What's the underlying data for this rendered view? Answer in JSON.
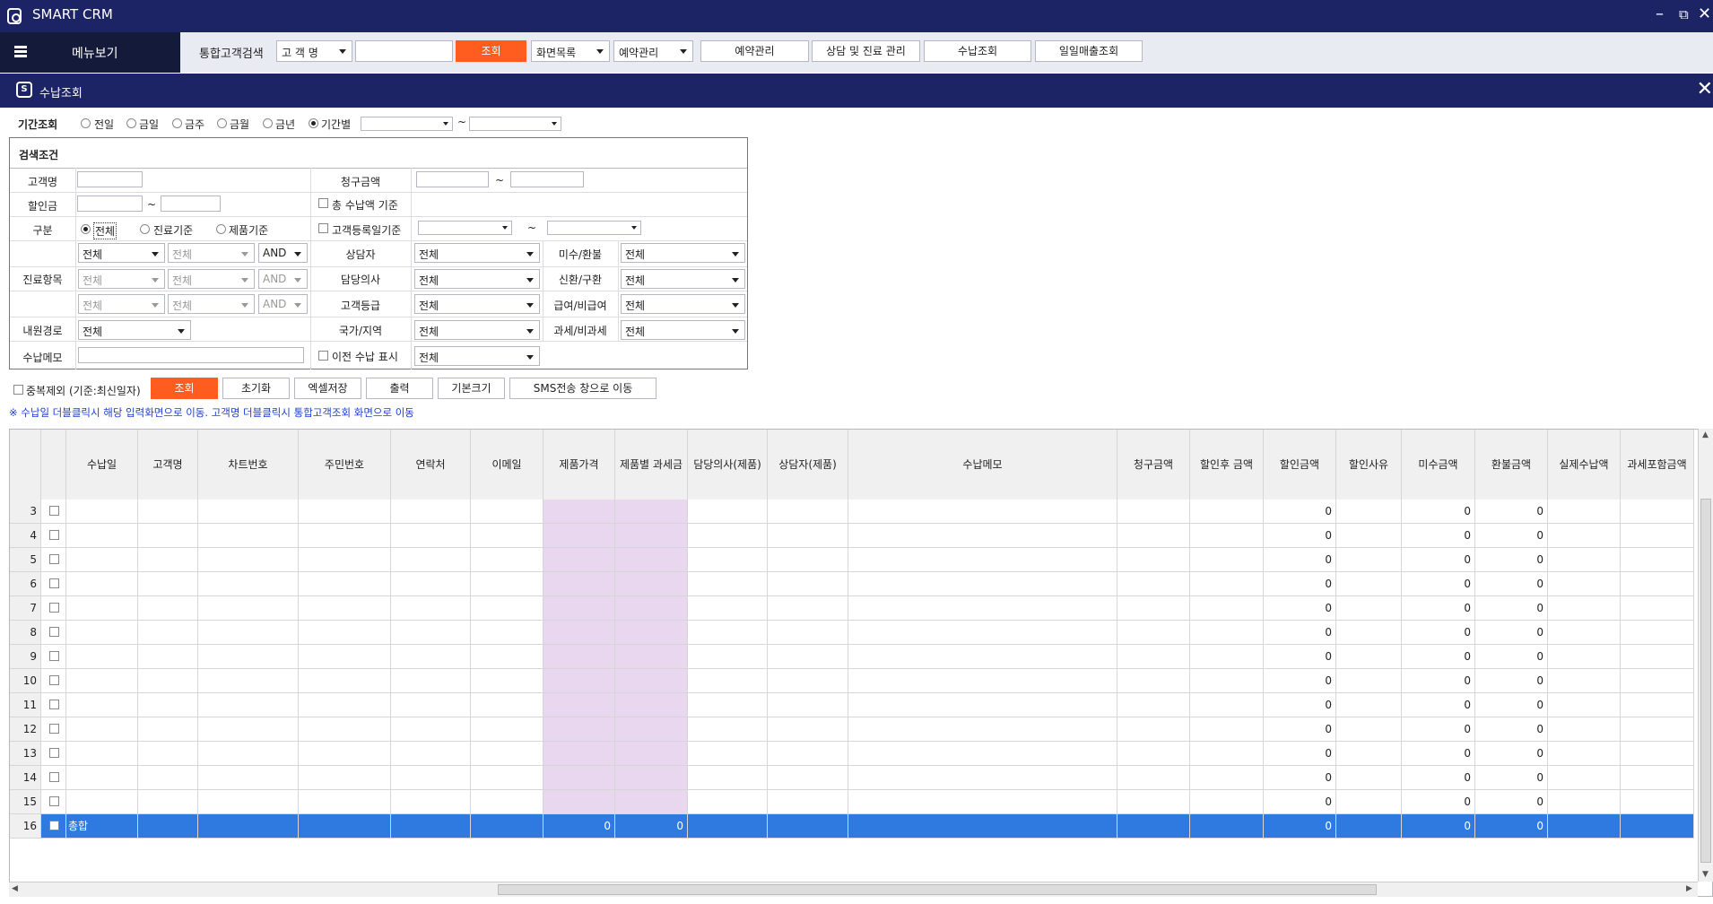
{
  "app": {
    "title": "SMART CRM"
  },
  "toolbar": {
    "menu_label": "메뉴보기",
    "search_label": "통합고객검색",
    "search_field_select": "고 객 명",
    "search_value": "",
    "search_button": "조회",
    "screen_list": "화면목록",
    "reservation_select": "예약관리",
    "quick_buttons": [
      "예약관리",
      "상담 및 진료 관리",
      "수납조회",
      "일일매출조회"
    ]
  },
  "subwindow": {
    "icon_letter": "S",
    "title": "수납조회"
  },
  "period": {
    "label": "기간조회",
    "options": [
      "전일",
      "금일",
      "금주",
      "금월",
      "금년",
      "기간별"
    ],
    "selected": "기간별",
    "tilde": "~"
  },
  "panel": {
    "title": "검색조건",
    "customer_name_label": "고객명",
    "charge_amount_label": "청구금액",
    "discount_label": "할인금",
    "total_paid_basis": "총 수납액 기준",
    "category_label": "구분",
    "category_options": [
      "전체",
      "진료기준",
      "제품기준"
    ],
    "category_selected": "전체",
    "reg_date_basis": "고객등록일기준",
    "treatment_label": "진료항목",
    "treatment_rows": [
      [
        "전체",
        "전체",
        "AND"
      ],
      [
        "전체",
        "전체",
        "AND"
      ],
      [
        "전체",
        "전체",
        "AND"
      ]
    ],
    "counselor_label": "상담자",
    "counselor_value": "전체",
    "unpaid_label": "미수/환불",
    "unpaid_value": "전체",
    "doctor_label": "담당의사",
    "doctor_value": "전체",
    "newold_label": "신환/구환",
    "newold_value": "전체",
    "grade_label": "고객등급",
    "grade_value": "전체",
    "benefit_label": "급여/비급여",
    "benefit_value": "전체",
    "route_label": "내원경로",
    "route_value": "전체",
    "country_label": "국가/지역",
    "country_value": "전체",
    "tax_label": "과세/비과세",
    "tax_value": "전체",
    "memo_label": "수납메모",
    "prev_paid_label": "이전 수납 표시",
    "prev_paid_value": "전체",
    "tilde": "~"
  },
  "actions": {
    "dedupe_label": "중복제외 (기준:최신일자)",
    "buttons": [
      "조회",
      "초기화",
      "엑셀저장",
      "출력",
      "기본크기",
      "SMS전송 창으로 이동"
    ]
  },
  "notice": "※ 수납일 더블클릭시 해당 입력화면으로 이동. 고객명 더블클릭시 통합고객조회 화면으로 이동",
  "table": {
    "columns": [
      "수납일",
      "고객명",
      "차트번호",
      "주민번호",
      "연락처",
      "이메일",
      "제품가격",
      "제품별 과세금",
      "담당의사(제품)",
      "상담자(제품)",
      "수납메모",
      "청구금액",
      "할인후 금액",
      "할인금액",
      "할인사유",
      "미수금액",
      "환불금액",
      "실제수납액",
      "과세포함금액"
    ],
    "rows": [
      {
        "n": "3",
        "v": [
          "0",
          "0",
          "0"
        ]
      },
      {
        "n": "4",
        "v": [
          "0",
          "0",
          "0"
        ]
      },
      {
        "n": "5",
        "v": [
          "0",
          "0",
          "0"
        ]
      },
      {
        "n": "6",
        "v": [
          "0",
          "0",
          "0"
        ]
      },
      {
        "n": "7",
        "v": [
          "0",
          "0",
          "0"
        ]
      },
      {
        "n": "8",
        "v": [
          "0",
          "0",
          "0"
        ]
      },
      {
        "n": "9",
        "v": [
          "0",
          "0",
          "0"
        ]
      },
      {
        "n": "10",
        "v": [
          "0",
          "0",
          "0"
        ]
      },
      {
        "n": "11",
        "v": [
          "0",
          "0",
          "0"
        ]
      },
      {
        "n": "12",
        "v": [
          "0",
          "0",
          "0"
        ]
      },
      {
        "n": "13",
        "v": [
          "0",
          "0",
          "0"
        ]
      },
      {
        "n": "14",
        "v": [
          "0",
          "0",
          "0"
        ]
      },
      {
        "n": "15",
        "v": [
          "0",
          "0",
          "0"
        ]
      }
    ],
    "total": {
      "n": "16",
      "label": "총합",
      "price": "0",
      "tax": "0",
      "discount": "0",
      "unpaid": "0",
      "refund": "0"
    }
  },
  "colors": {
    "navy": "#1c2466",
    "orange": "#ff5c1f",
    "select_blue": "#2e7ae0",
    "pink": "#e9d6ef"
  }
}
